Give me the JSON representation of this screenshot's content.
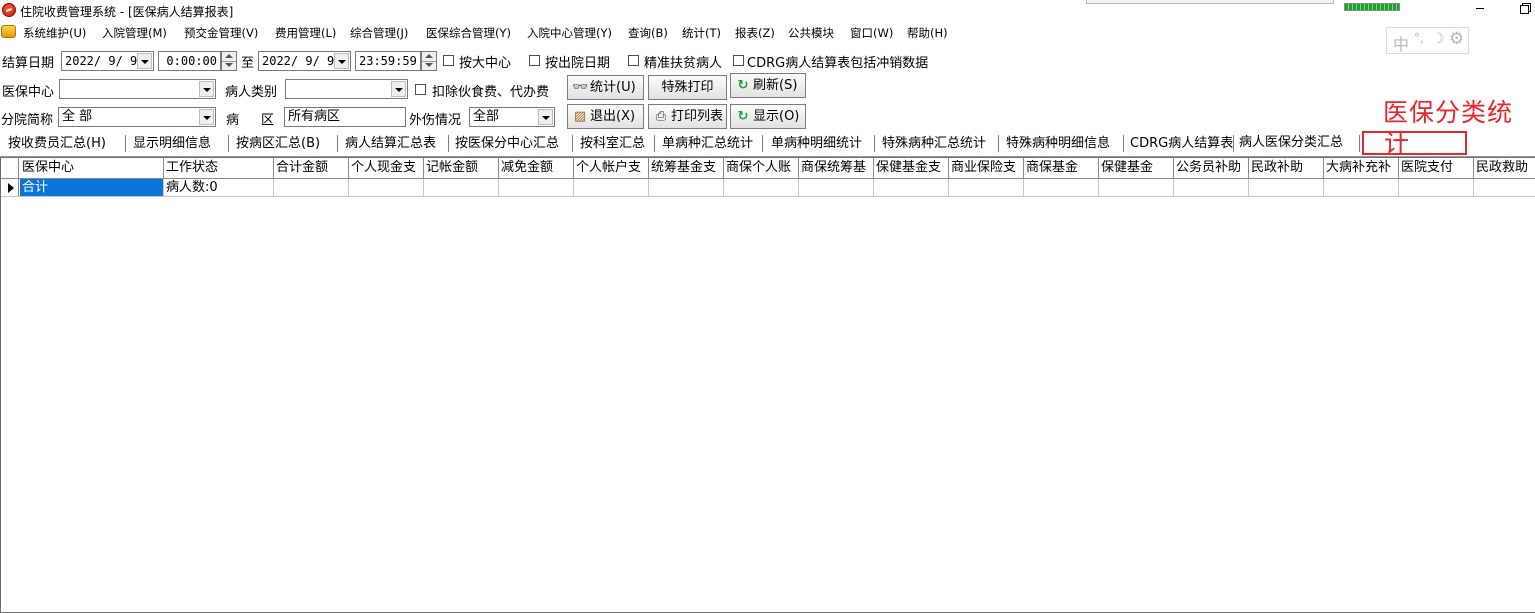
{
  "window": {
    "title": "住院收费管理系统 - [医保病人结算报表]",
    "progress_fraction": 1.0
  },
  "menu": [
    "系统维护(U)",
    "入院管理(M)",
    "预交金管理(V)",
    "费用管理(L)",
    "综合管理(J)",
    "医保综合管理(Y)",
    "入院中心管理(Y)",
    "查询(B)",
    "统计(T)",
    "报表(Z)",
    "公共模块",
    "窗口(W)",
    "帮助(H)"
  ],
  "ime": {
    "zh": "中",
    "dot": "°,",
    "moon": "☽",
    "gear": "⚙"
  },
  "filters": {
    "settle_date_label": "结算日期",
    "start_date": "2022/ 9/ 9",
    "start_time": "0:00:00",
    "to_label": "至",
    "end_date": "2022/ 9/ 9",
    "end_time": "23:59:59",
    "chk_by_center": "按大中心",
    "chk_by_discharge": "按出院日期",
    "chk_poverty": "精准扶贫病人",
    "chk_cdrg": "CDRG病人结算表包括冲销数据",
    "insurance_center_label": "医保中心",
    "insurance_center_value": "",
    "patient_type_label": "病人类别",
    "patient_type_value": "",
    "chk_exclude_meals": "扣除伙食费、代办费",
    "branch_label": "分院简称",
    "branch_value": "全 部",
    "ward_label_1": "病",
    "ward_label_2": "区",
    "ward_value": "所有病区",
    "injury_label": "外伤情况",
    "injury_value": "全部"
  },
  "buttons": {
    "stats": "统计(U)",
    "special_print": "特殊打印",
    "refresh": "刷新(S)",
    "exit": "退出(X)",
    "print_list": "打印列表",
    "display": "显示(O)"
  },
  "annotation": {
    "text_line1": "医保分类统",
    "text_line2": "计"
  },
  "tabs": [
    "按收费员汇总(H)",
    "显示明细信息",
    "按病区汇总(B)",
    "病人结算汇总表",
    "按医保分中心汇总",
    "按科室汇总",
    "单病种汇总统计",
    "单病种明细统计",
    "特殊病种汇总统计",
    "特殊病种明细信息",
    "CDRG病人结算表",
    "病人医保分类汇总"
  ],
  "active_tab": "病人医保分类汇总",
  "table": {
    "columns": [
      "医保中心",
      "工作状态",
      "合计金额",
      "个人现金支",
      "记帐金额",
      "减免金额",
      "个人帐户支",
      "统筹基金支",
      "商保个人账",
      "商保统筹基",
      "保健基金支",
      "商业保险支",
      "商保基金",
      "保健基金",
      "公务员补助",
      "民政补助",
      "大病补充补",
      "医院支付",
      "民政救助"
    ],
    "rows": [
      [
        "合计",
        "病人数:0",
        "",
        "",
        "",
        "",
        "",
        "",
        "",
        "",
        "",
        "",
        "",
        "",
        "",
        "",
        "",
        "",
        ""
      ]
    ]
  }
}
